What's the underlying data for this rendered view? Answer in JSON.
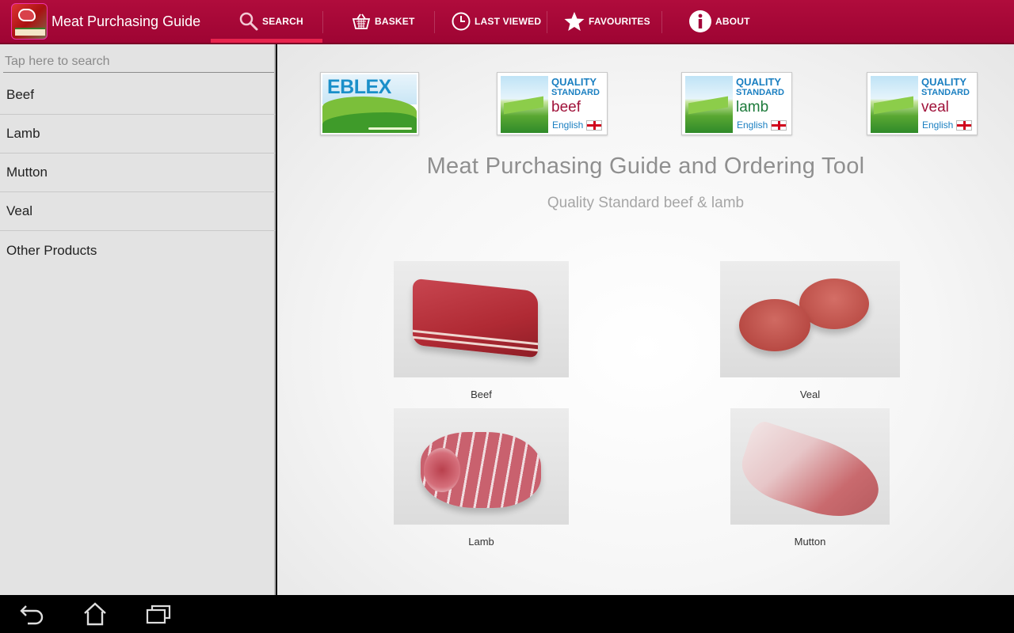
{
  "app": {
    "title": "Meat Purchasing Guide",
    "icon": "app-logo-icon",
    "colors": {
      "actionbar": "#a3063a",
      "active_tab_indicator": "#e8244e",
      "sidebar_bg": "#e3e3e3"
    }
  },
  "tabs": [
    {
      "label": "SEARCH",
      "icon": "search-icon",
      "active": true
    },
    {
      "label": "BASKET",
      "icon": "basket-icon",
      "active": false
    },
    {
      "label": "LAST VIEWED",
      "icon": "clock-icon",
      "active": false
    },
    {
      "label": "FAVOURITES",
      "icon": "star-icon",
      "active": false
    },
    {
      "label": "ABOUT",
      "icon": "info-icon",
      "active": false
    }
  ],
  "sidebar": {
    "search": {
      "placeholder": "Tap here to search",
      "value": ""
    },
    "categories": [
      {
        "label": "Beef"
      },
      {
        "label": "Lamb"
      },
      {
        "label": "Mutton"
      },
      {
        "label": "Veal"
      },
      {
        "label": "Other Products"
      }
    ]
  },
  "main": {
    "logos": [
      {
        "name": "EBLEX",
        "text": "EBLEX"
      },
      {
        "name": "Quality Standard beef",
        "line1": "QUALITY",
        "line2": "STANDARD",
        "meat": "beef",
        "origin": "English"
      },
      {
        "name": "Quality Standard lamb",
        "line1": "QUALITY",
        "line2": "STANDARD",
        "meat": "lamb",
        "origin": "English"
      },
      {
        "name": "Quality Standard veal",
        "line1": "QUALITY",
        "line2": "STANDARD",
        "meat": "veal",
        "origin": "English"
      }
    ],
    "title": "Meat Purchasing Guide and Ordering Tool",
    "subtitle": "Quality Standard beef & lamb",
    "products": [
      {
        "label": "Beef"
      },
      {
        "label": "Veal"
      },
      {
        "label": "Lamb"
      },
      {
        "label": "Mutton"
      }
    ]
  },
  "navbar": {
    "buttons": [
      {
        "name": "back",
        "icon": "back-icon"
      },
      {
        "name": "home",
        "icon": "home-icon"
      },
      {
        "name": "recent-apps",
        "icon": "recent-apps-icon"
      }
    ]
  }
}
